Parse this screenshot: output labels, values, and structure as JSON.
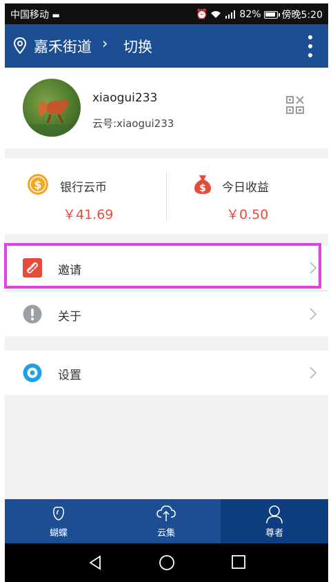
{
  "status_bar": {
    "carrier": "中国移动",
    "battery": "82%",
    "time": "傍晚5:20"
  },
  "header": {
    "location": "嘉禾街道",
    "chevron": "›",
    "switch_label": "切换"
  },
  "profile": {
    "username": "xiaogui233",
    "cloud_id": "云号:xiaogui233"
  },
  "stats": [
    {
      "label": "银行云币",
      "value": "￥41.69",
      "icon": "coin-icon"
    },
    {
      "label": "今日收益",
      "value": "￥0.50",
      "icon": "money-bag-icon"
    }
  ],
  "menu": [
    {
      "label": "邀请",
      "icon": "link-icon"
    },
    {
      "label": "关于",
      "icon": "info-icon"
    },
    {
      "label": "设置",
      "icon": "settings-icon"
    }
  ],
  "bottom_nav": [
    {
      "label": "蝴蝶",
      "icon": "butterfly-icon"
    },
    {
      "label": "云集",
      "icon": "cloud-icon"
    },
    {
      "label": "尊者",
      "icon": "user-icon",
      "active": true
    }
  ],
  "colors": {
    "header": "#1c4e94",
    "accent_red": "#e74b3c",
    "coin": "#f5a623",
    "highlight": "#e43ee6"
  }
}
